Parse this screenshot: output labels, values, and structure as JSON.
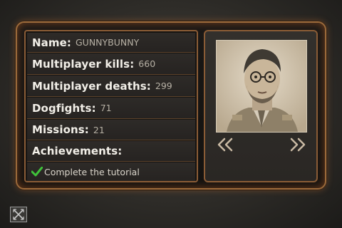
{
  "profile": {
    "name_label": "Name:",
    "name_value": "GUNNYBUNNY",
    "kills_label": "Multiplayer kills:",
    "kills_value": "660",
    "deaths_label": "Multiplayer deaths:",
    "deaths_value": "299",
    "dogfights_label": "Dogfights:",
    "dogfights_value": "71",
    "missions_label": "Missions:",
    "missions_value": "21",
    "achievements_label": "Achievements:",
    "achievements": [
      "Complete the tutorial"
    ]
  },
  "colors": {
    "frame_orange": "#9c6a3a",
    "check_green": "#3fc23a"
  },
  "icons": {
    "prev": "double-chevron-left-icon",
    "next": "double-chevron-right-icon",
    "close": "close-icon",
    "check": "checkmark-icon"
  }
}
